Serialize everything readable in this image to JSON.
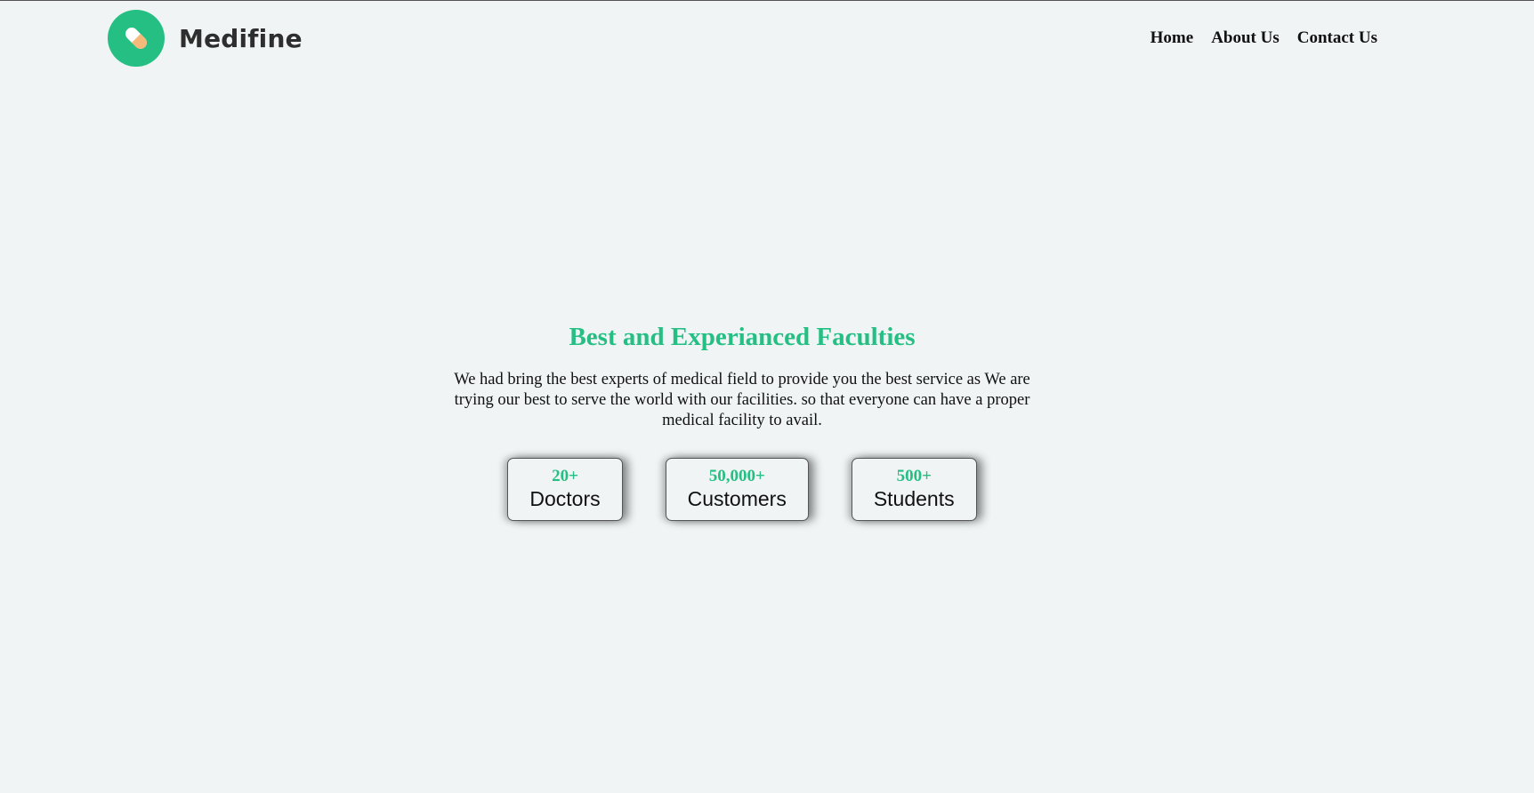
{
  "header": {
    "brand": "Medifine",
    "logo_icon": "pill-icon",
    "nav": [
      {
        "label": "Home"
      },
      {
        "label": "About Us"
      },
      {
        "label": "Contact Us"
      }
    ]
  },
  "hero": {
    "title": "Best and Experianced Faculties",
    "description": "We had bring the best experts of medical field to provide you the best service as We are trying our best to serve the world with our facilities. so that everyone can have a proper medical facility to avail.",
    "stats": [
      {
        "value": "20+",
        "label": "Doctors"
      },
      {
        "value": "50,000+",
        "label": "Customers"
      },
      {
        "value": "500+",
        "label": "Students"
      }
    ]
  },
  "colors": {
    "accent": "#25bf84",
    "background": "#f0f4f5",
    "pill_orange": "#f5b97a"
  }
}
